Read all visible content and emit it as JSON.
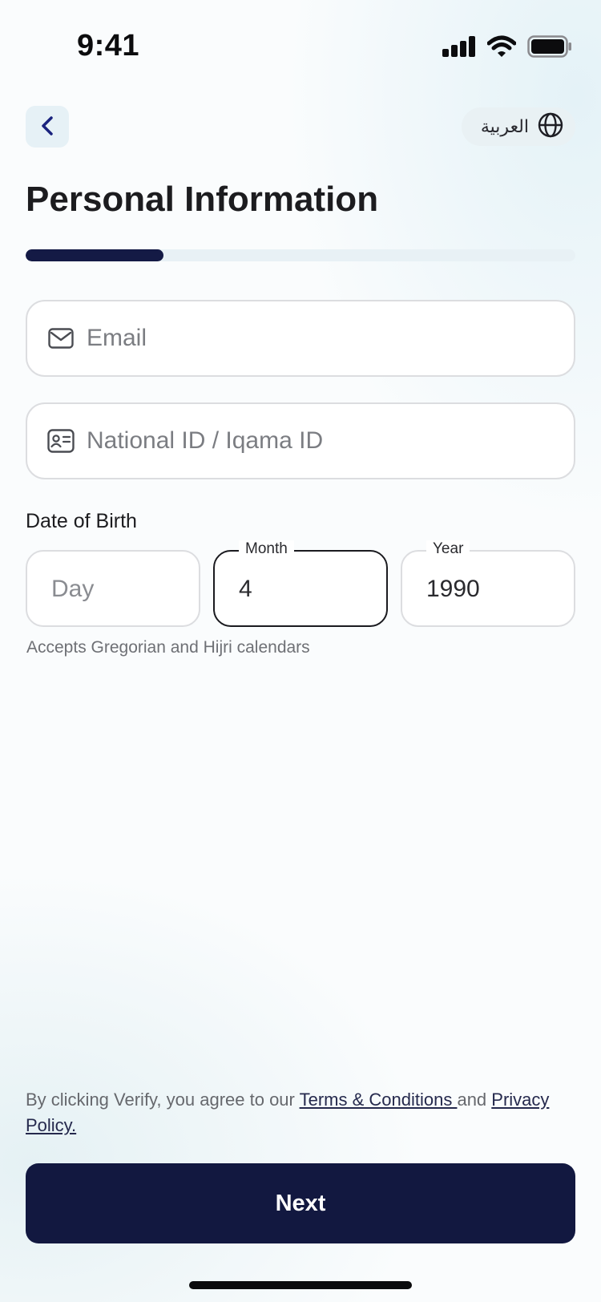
{
  "status": {
    "time": "9:41",
    "icons": [
      "cellular-signal-icon",
      "wifi-icon",
      "battery-icon"
    ]
  },
  "header": {
    "back_icon": "chevron-left-icon",
    "language_label": "العربية",
    "language_icon": "globe-icon"
  },
  "title": "Personal Information",
  "progress": {
    "fraction": 0.25
  },
  "fields": {
    "email": {
      "placeholder": "Email",
      "value": "",
      "icon": "envelope-icon"
    },
    "national_id": {
      "placeholder": "National ID / Iqama ID",
      "value": "",
      "icon": "id-card-icon"
    }
  },
  "dob": {
    "label": "Date of Birth",
    "day": {
      "placeholder": "Day",
      "value": ""
    },
    "month": {
      "label": "Month",
      "value": "4"
    },
    "year": {
      "label": "Year",
      "value": "1990"
    },
    "hint": "Accepts Gregorian and Hijri calendars"
  },
  "legal": {
    "prefix": "By clicking Verify, you agree to our ",
    "terms_link": "Terms & Conditions ",
    "connector": "and ",
    "privacy_link": "Privacy Policy."
  },
  "footer": {
    "next_label": "Next"
  },
  "colors": {
    "primary": "#121840",
    "progress_track": "#e8f1f5",
    "field_border": "#dcdde0"
  }
}
